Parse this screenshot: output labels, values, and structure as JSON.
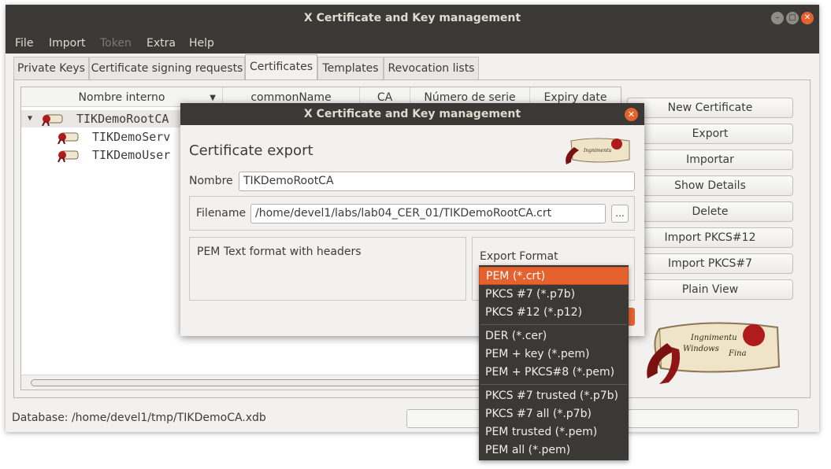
{
  "window": {
    "title": "X Certificate and Key management"
  },
  "menu": {
    "file": "File",
    "import": "Import",
    "token": "Token",
    "extra": "Extra",
    "help": "Help"
  },
  "tabs": [
    "Private Keys",
    "Certificate signing requests",
    "Certificates",
    "Templates",
    "Revocation lists"
  ],
  "active_tab": "Certificates",
  "tree": {
    "columns": [
      "Nombre interno",
      "commonName",
      "CA",
      "Número de serie",
      "Expiry date"
    ],
    "rows": [
      "TIKDemoRootCA",
      "TIKDemoServ",
      "TIKDemoUser"
    ]
  },
  "buttons": {
    "new_certificate": "New Certificate",
    "export": "Export",
    "import": "Importar",
    "show_details": "Show Details",
    "delete": "Delete",
    "import_pkcs12": "Import PKCS#12",
    "import_pkcs7": "Import PKCS#7",
    "plain_view": "Plain View"
  },
  "status": {
    "database": "Database: /home/devel1/tmp/TIKDemoCA.xdb"
  },
  "dialog": {
    "title": "X Certificate and Key management",
    "heading": "Certificate export",
    "name_label": "Nombre",
    "name_value": "TIKDemoRootCA",
    "filename_label": "Filename",
    "filename_value": "/home/devel1/labs/lab04_CER_01/TIKDemoRootCA.crt",
    "browse_label": "...",
    "description": "PEM Text format with headers",
    "format_label": "Export Format"
  },
  "export_formats": {
    "selected": "PEM (*.crt)",
    "group1": [
      "PEM (*.crt)",
      "PKCS #7 (*.p7b)",
      "PKCS #12 (*.p12)"
    ],
    "group2": [
      "DER (*.cer)",
      "PEM + key (*.pem)",
      "PEM + PKCS#8 (*.pem)"
    ],
    "group3": [
      "PKCS #7 trusted (*.p7b)",
      "PKCS #7 all (*.p7b)",
      "PEM trusted (*.pem)",
      "PEM all (*.pem)"
    ]
  },
  "colors": {
    "titlebar": "#3a3936",
    "accent": "#e5622e",
    "seal": "#b01c1c"
  },
  "icons": [
    "close-icon",
    "minimize-icon",
    "maximize-icon",
    "expand-triangle-icon",
    "certificate-icon",
    "sort-arrow-icon",
    "xca-logo"
  ]
}
